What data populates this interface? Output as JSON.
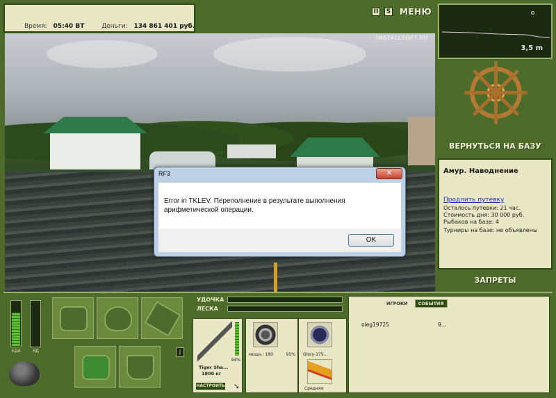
{
  "status": {
    "time_label": "Время:",
    "time_value": "05:40 ВТ",
    "money_label": "Деньги:",
    "money_value": "134 861 401 руб."
  },
  "toolbar": {
    "pause_icon": "pause-icon",
    "help_icon": "help-icon",
    "pause_label": "II",
    "help_label": "S",
    "menu_label": "МЕНЮ"
  },
  "scene": {
    "watermark": "INSTALLSOFT.RU"
  },
  "depth": {
    "value": "3,5 m"
  },
  "base": {
    "return_label": "ВЕРНУТЬСЯ НА БАЗУ",
    "location": "Амур. Наводнение",
    "extend_link": "Продлить путевку",
    "lines": [
      "Осталось путевки: 21 час.",
      "Стоимость дня: 30 000 руб.",
      "Рыбаков на базе: 4",
      "Турниры на базе: не объявлены"
    ],
    "bans_label": "ЗАПРЕТЫ"
  },
  "meters": {
    "food_label": "ЕДА",
    "energy_label": "ЯД",
    "food_level": 0.72,
    "energy_level": 0.0
  },
  "tackle": {
    "rod_label": "УДОЧКА",
    "line_label": "ЛЕСКА",
    "rod_name": "Tiger Sha...",
    "rod_weight": "1800 кг",
    "rod_percent": "94%",
    "setup_label": "НАСТРОИТЬ",
    "reel_label": "мощн.: 180",
    "reel_percent": "95%",
    "line_name": "Glory-175...",
    "lure_label": "Средняя"
  },
  "players": {
    "tab_players": "ИГРОКИ",
    "tab_events": "СОБЫТИЯ",
    "rows": [
      {
        "name": "oleg19725",
        "value": "9..."
      }
    ]
  },
  "dialog": {
    "title": "RF3",
    "close_label": "✕",
    "message": "Error in TKLEV. Переполнение в результате выполнения арифметической операции.",
    "ok_label": "OK"
  }
}
